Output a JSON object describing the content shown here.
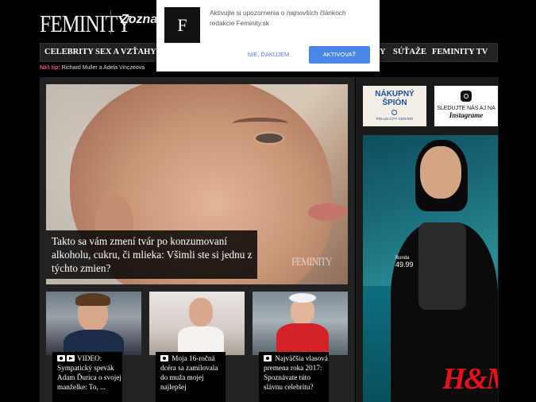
{
  "header": {
    "logo": "FEMINITY",
    "partner": "Zoznam"
  },
  "nav": {
    "items": [
      "CELEBRITY",
      "SEX A VZŤAHY",
      "Y",
      "SÚŤAŽE",
      "FEMINITY TV"
    ]
  },
  "tip": {
    "label": "Náš tip:",
    "text": "Richard Muller a Adela Vinczeova"
  },
  "notification": {
    "icon_letter": "F",
    "message": "Aktivujte si upozornenia o najnovších článkoch redakcie Feminity.sk",
    "deny_label": "NIE, ĎAKUJEM",
    "allow_label": "AKTIVOVAŤ"
  },
  "hero": {
    "title": "Takto sa vám zmení tvár po konzumovaní alkoholu, cukru, či mlieka: Všimli ste si jednu z týchto zmien?",
    "watermark": "FEMINITY"
  },
  "cards": [
    {
      "prefix": "VIDEO:",
      "text": "Sympatický spevák Adam Ďurica o svojej manželke: To, ..."
    },
    {
      "prefix": "",
      "text": "Moja 16-ročná dcéra sa zamilovala do muža mojej najlepšej"
    },
    {
      "prefix": "",
      "text": "Najväčšia vlasová premena roka 2017: Spoznávate túto slávnu celebritu?"
    }
  ],
  "sidebar": {
    "spion_title": "NÁKUPNÝ ŠPIÓN",
    "spion_sub": "POLUS CITY CENTER",
    "insta_text": "SLEDUJTE NÁS AJ NA",
    "insta_brand": "Instagrame",
    "ad_product": "Bunda",
    "ad_price": "49.99",
    "ad_brand": "H&M"
  },
  "colors": {
    "accent_pink": "#e8557a",
    "button_blue": "#4a86e8",
    "hm_red": "#e8101f"
  }
}
